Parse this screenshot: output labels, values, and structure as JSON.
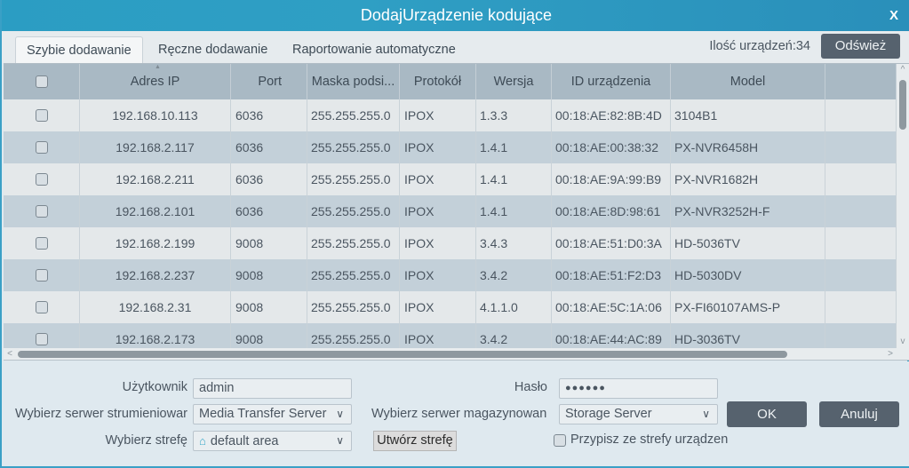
{
  "window": {
    "title": "DodajUrządzenie kodujące",
    "close_label": "X"
  },
  "tabs": [
    {
      "label": "Szybie dodawanie",
      "active": true
    },
    {
      "label": "Ręczne dodawanie",
      "active": false
    },
    {
      "label": "Raportowanie automatyczne",
      "active": false
    }
  ],
  "device_count_label": "Ilość urządzeń:34",
  "refresh_label": "Odśwież",
  "table": {
    "columns": [
      "",
      "Adres IP",
      "Port",
      "Maska podsi...",
      "Protokół",
      "Wersja",
      "ID urządzenia",
      "Model",
      ""
    ],
    "rows": [
      {
        "checked": false,
        "ip": "192.168.10.113",
        "port": "6036",
        "mask": "255.255.255.0",
        "protocol": "IPOX",
        "version": "1.3.3",
        "id": "00:18:AE:82:8B:4D",
        "model": "3104B1"
      },
      {
        "checked": false,
        "ip": "192.168.2.117",
        "port": "6036",
        "mask": "255.255.255.0",
        "protocol": "IPOX",
        "version": "1.4.1",
        "id": "00:18:AE:00:38:32",
        "model": "PX-NVR6458H"
      },
      {
        "checked": false,
        "ip": "192.168.2.211",
        "port": "6036",
        "mask": "255.255.255.0",
        "protocol": "IPOX",
        "version": "1.4.1",
        "id": "00:18:AE:9A:99:B9",
        "model": "PX-NVR1682H"
      },
      {
        "checked": false,
        "ip": "192.168.2.101",
        "port": "6036",
        "mask": "255.255.255.0",
        "protocol": "IPOX",
        "version": "1.4.1",
        "id": "00:18:AE:8D:98:61",
        "model": "PX-NVR3252H-F"
      },
      {
        "checked": false,
        "ip": "192.168.2.199",
        "port": "9008",
        "mask": "255.255.255.0",
        "protocol": "IPOX",
        "version": "3.4.3",
        "id": "00:18:AE:51:D0:3A",
        "model": "HD-5036TV"
      },
      {
        "checked": false,
        "ip": "192.168.2.237",
        "port": "9008",
        "mask": "255.255.255.0",
        "protocol": "IPOX",
        "version": "3.4.2",
        "id": "00:18:AE:51:F2:D3",
        "model": "HD-5030DV"
      },
      {
        "checked": false,
        "ip": "192.168.2.31",
        "port": "9008",
        "mask": "255.255.255.0",
        "protocol": "IPOX",
        "version": "4.1.1.0",
        "id": "00:18:AE:5C:1A:06",
        "model": "PX-FI60107AMS-P"
      },
      {
        "checked": false,
        "ip": "192.168.2.173",
        "port": "9008",
        "mask": "255.255.255.0",
        "protocol": "IPOX",
        "version": "3.4.2",
        "id": "00:18:AE:44:AC:89",
        "model": "HD-3036TV"
      }
    ]
  },
  "form": {
    "user_label": "Użytkownik",
    "user_value": "admin",
    "password_label": "Hasło",
    "password_value": "●●●●●●",
    "stream_server_label": "Wybierz serwer strumieniowar",
    "stream_server_value": "Media Transfer Server",
    "storage_server_label": "Wybierz serwer magazynowan",
    "storage_server_value": "Storage Server",
    "area_label": "Wybierz strefę",
    "area_value": "default area",
    "create_area_label": "Utwórz strefę",
    "assign_label": "Przypisz ze strefy urządzeni",
    "assign_checked": false,
    "ok_label": "OK",
    "cancel_label": "Anuluj"
  },
  "icons": {
    "chevron": "∨",
    "home": "⌂",
    "scroll_up": "^",
    "scroll_down": "v",
    "scroll_left": "<",
    "scroll_right": ">",
    "sort": "▲"
  }
}
